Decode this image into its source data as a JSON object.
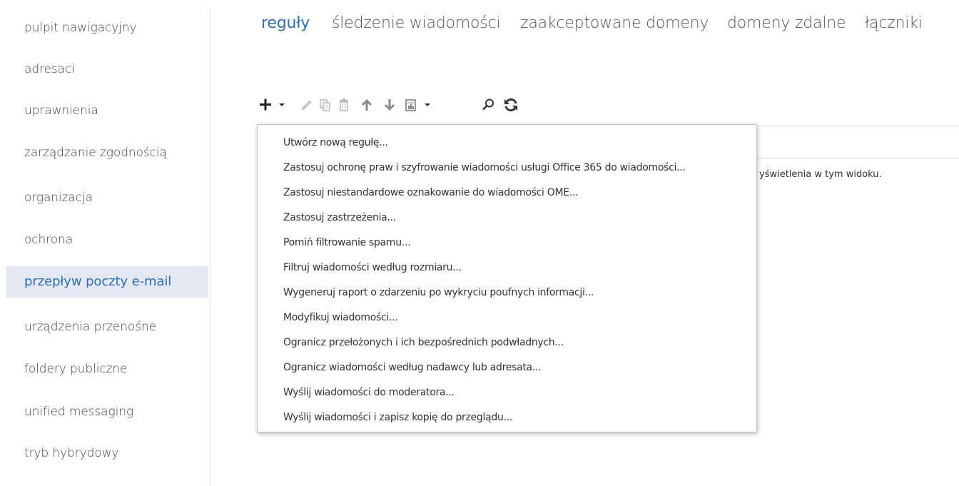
{
  "nav": {
    "items": [
      {
        "label": "pulpit nawigacyjny"
      },
      {
        "label": "adresaci"
      },
      {
        "label": "uprawnienia"
      },
      {
        "label": "zarządzanie zgodnością"
      },
      {
        "label": "organizacja"
      },
      {
        "label": "ochrona"
      },
      {
        "label": "przepływ poczty e-mail",
        "selected": true
      },
      {
        "label": "urządzenia przenośne"
      },
      {
        "label": "foldery publiczne"
      },
      {
        "label": "unified messaging"
      },
      {
        "label": "tryb hybrydowy"
      }
    ]
  },
  "tabs": [
    {
      "label": "reguły",
      "active": true
    },
    {
      "label": "śledzenie wiadomości"
    },
    {
      "label": "zaakceptowane domeny"
    },
    {
      "label": "domeny zdalne"
    },
    {
      "label": "łączniki"
    }
  ],
  "toolbar": {
    "icons": [
      "add-icon",
      "edit-icon",
      "copy-icon",
      "delete-icon",
      "move-up-icon",
      "move-down-icon",
      "export-icon",
      "search-icon",
      "refresh-icon"
    ]
  },
  "list": {
    "empty_text": "yświetlenia w tym widoku."
  },
  "menu": {
    "items": [
      "Utwórz nową regułę...",
      "Zastosuj ochronę praw i szyfrowanie wiadomości usługi Office 365 do wiadomości...",
      "Zastosuj niestandardowe oznakowanie do wiadomości OME...",
      "Zastosuj zastrzeżenia...",
      "Pomiń filtrowanie spamu...",
      "Filtruj wiadomości według rozmiaru...",
      "Wygeneruj raport o zdarzeniu po wykryciu poufnych informacji...",
      "Modyfikuj wiadomości...",
      "Ogranicz przełożonych i ich bezpośrednich podwładnych...",
      "Ogranicz wiadomości według nadawcy lub adresata...",
      "Wyślij wiadomości do moderatora...",
      "Wyślij wiadomości i zapisz kopię do przeglądu..."
    ]
  },
  "colors": {
    "accent": "#2f6fb6",
    "nav_selected_bg": "#e3e8f2",
    "disabled_icon": "#b3b3b3",
    "text": "#333333"
  }
}
